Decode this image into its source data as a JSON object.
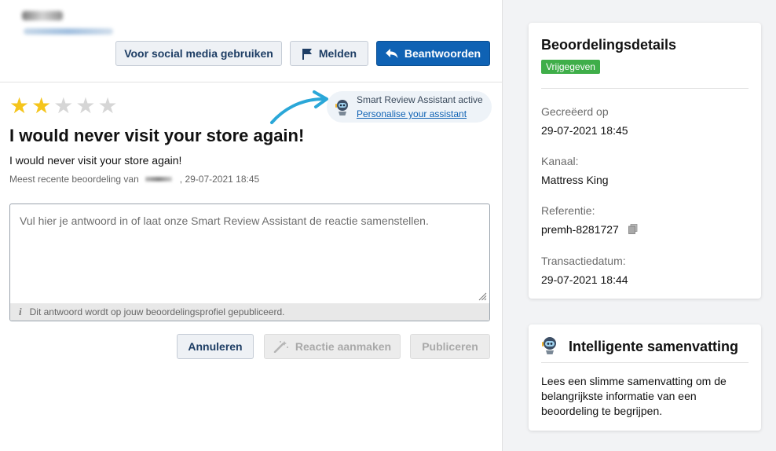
{
  "header": {
    "social_button": "Voor social media gebruiken",
    "report_button": "Melden",
    "reply_button": "Beantwoorden"
  },
  "review": {
    "rating": 2,
    "max_rating": 5,
    "title": "I would never visit your store again!",
    "text": "I would never visit your store again!",
    "meta_prefix": "Meest recente beoordeling van",
    "meta_date": ", 29-07-2021 18:45"
  },
  "assistant": {
    "status": "Smart Review Assistant active",
    "link": "Personalise your assistant"
  },
  "reply": {
    "placeholder": "Vul hier je antwoord in of laat onze Smart Review Assistant de reactie samenstellen.",
    "footer_note": "Dit antwoord wordt op jouw beoordelingsprofiel gepubliceerd.",
    "cancel_button": "Annuleren",
    "generate_button": "Reactie aanmaken",
    "publish_button": "Publiceren"
  },
  "details": {
    "title": "Beoordelingsdetails",
    "status_badge": "Vrijgegeven",
    "created_label": "Gecreëerd op",
    "created_value": "29-07-2021 18:45",
    "channel_label": "Kanaal:",
    "channel_value": "Mattress King",
    "reference_label": "Referentie:",
    "reference_value": "premh-8281727",
    "transaction_label": "Transactiedatum:",
    "transaction_value": "29-07-2021 18:44"
  },
  "summary_card": {
    "title": "Intelligente samenvatting",
    "text": "Lees een slimme samenvatting om de belangrijkste informatie van een beoordeling te begrijpen."
  },
  "colors": {
    "primary": "#0f62b4",
    "star": "#f5c51c",
    "badge": "#3fae49",
    "arrow": "#2aa7d8"
  }
}
